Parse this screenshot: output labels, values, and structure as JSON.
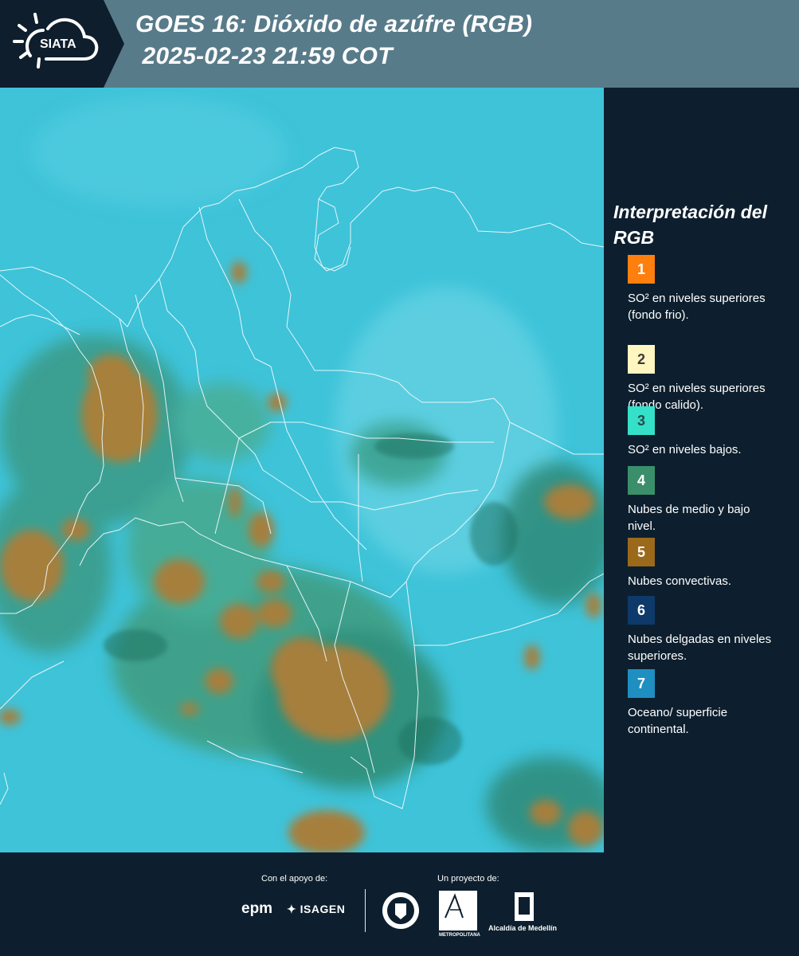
{
  "header": {
    "logo_text": "SIATA",
    "title_line_1": "GOES 16: Dióxido de azúfre (RGB)",
    "title_line_2": " 2025-02-23 21:59 COT"
  },
  "legend": {
    "title": "Interpretación del RGB",
    "items": [
      {
        "number": "1",
        "label": "SO² en niveles superiores (fondo frio).",
        "color": "#ff7f0e",
        "text_color": "#ffffff"
      },
      {
        "number": "2",
        "label": "SO² en niveles superiores (fondo calido).",
        "color": "#fff6c0",
        "text_color": "#3a3a3a"
      },
      {
        "number": "3",
        "label": "SO² en niveles bajos.",
        "color": "#34e0c8",
        "text_color": "#2a4a4a"
      },
      {
        "number": "4",
        "label": "Nubes de medio y bajo nivel.",
        "color": "#3a8f6a",
        "text_color": "#ffffff"
      },
      {
        "number": "5",
        "label": "Nubes convectivas.",
        "color": "#9a6a1a",
        "text_color": "#ffffff"
      },
      {
        "number": "6",
        "label": "Nubes delgadas en niveles superiores.",
        "color": "#0d3a6a",
        "text_color": "#ffffff"
      },
      {
        "number": "7",
        "label": "Oceano/ superficie continental.",
        "color": "#1e8fc0",
        "text_color": "#ffffff"
      }
    ]
  },
  "footer": {
    "support_label": "Con el apoyo de:",
    "project_label": "Un proyecto de:",
    "sponsor_1": "epm",
    "sponsor_2": "ISAGEN",
    "partner_1_text": "METROPOLITANA",
    "partner_2_text": "Alcaldía de Medellín"
  }
}
